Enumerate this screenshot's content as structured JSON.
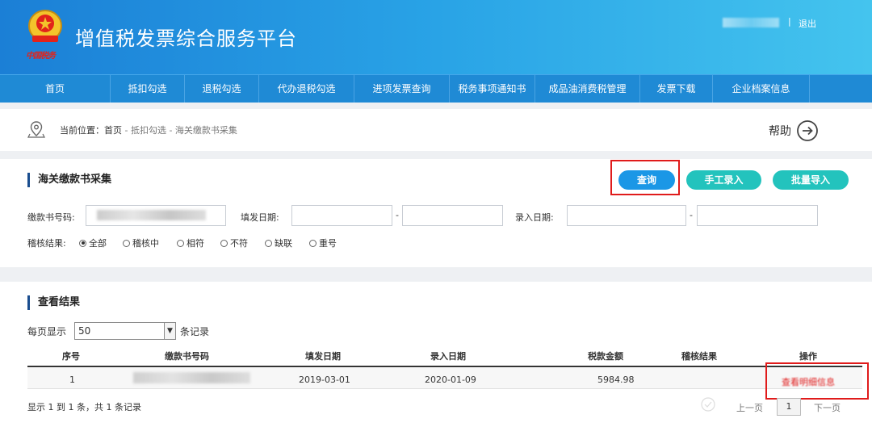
{
  "header": {
    "title": "增值税发票综合服务平台",
    "emblem_caption": "中国税务",
    "separator": "|",
    "logout_label": "退出"
  },
  "nav": {
    "items": [
      {
        "label": "首页"
      },
      {
        "label": "抵扣勾选"
      },
      {
        "label": "退税勾选"
      },
      {
        "label": "代办退税勾选"
      },
      {
        "label": "进项发票查询"
      },
      {
        "label": "税务事项通知书"
      },
      {
        "label": "成品油消费税管理"
      },
      {
        "label": "发票下载"
      },
      {
        "label": "企业档案信息"
      }
    ]
  },
  "breadcrumb": {
    "prefix": "当前位置：",
    "home": "首页",
    "path": " - 抵扣勾选 - 海关缴款书采集",
    "help_label": "帮助"
  },
  "search": {
    "title": "海关缴款书采集",
    "query_button": "查询",
    "manual_button": "手工录入",
    "batch_button": "批量导入",
    "payment_no_label": "缴款书号码:",
    "issue_date_label": "填发日期:",
    "entry_date_label": "录入日期:",
    "range_separator": "-",
    "check_result_label": "稽核结果:",
    "check_options": [
      {
        "label": "全部",
        "selected": true
      },
      {
        "label": "稽核中",
        "selected": false
      },
      {
        "label": "相符",
        "selected": false
      },
      {
        "label": "不符",
        "selected": false
      },
      {
        "label": "缺联",
        "selected": false
      },
      {
        "label": "重号",
        "selected": false
      }
    ]
  },
  "results": {
    "title": "查看结果",
    "page_size_label": "每页显示",
    "page_size_value": "50",
    "records_label": "条记录",
    "columns": [
      "序号",
      "缴款书号码",
      "填发日期",
      "录入日期",
      "税款金额",
      "稽核结果",
      "操作"
    ],
    "rows": [
      {
        "index": "1",
        "issue_date": "2019-03-01",
        "entry_date": "2020-01-09",
        "tax_amount": "5984.98",
        "check_result": "",
        "operation": "查看明细信息"
      }
    ],
    "summary": "显示 1 到 1 条，共 1 条记录",
    "pager": {
      "prev": "上一页",
      "current": "1",
      "next": "下一页"
    }
  },
  "colors": {
    "header_start": "#1b7fd6",
    "header_end": "#44c4ee",
    "nav_bg": "#1f8ad5",
    "query_button": "#1b97e6",
    "teal_button": "#23c3bd",
    "highlight_box": "#e01b1b"
  },
  "icons": [
    "national-emblem-icon",
    "location-icon",
    "arrow-right-circle-icon",
    "chevron-down-icon"
  ]
}
